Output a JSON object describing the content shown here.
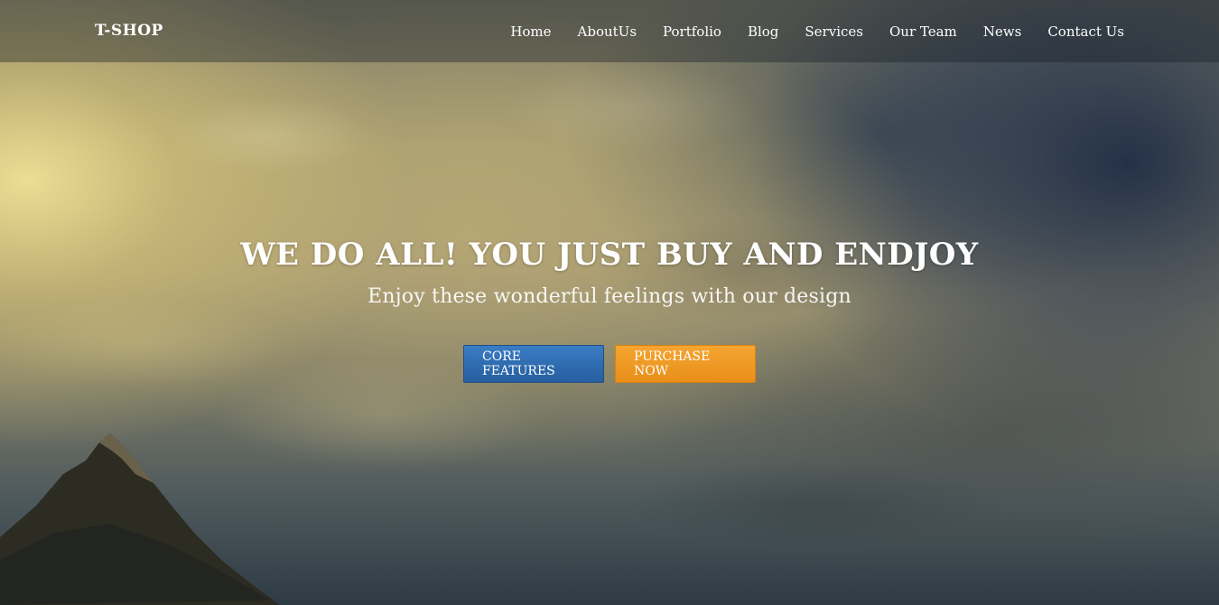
{
  "header": {
    "brand": "T-SHOP",
    "nav": [
      {
        "label": "Home"
      },
      {
        "label": "AboutUs"
      },
      {
        "label": "Portfolio"
      },
      {
        "label": "Blog"
      },
      {
        "label": "Services"
      },
      {
        "label": "Our Team"
      },
      {
        "label": "News"
      },
      {
        "label": "Contact Us"
      }
    ]
  },
  "hero": {
    "title": "WE DO ALL! YOU JUST BUY AND ENDJOY",
    "subtitle": "Enjoy these wonderful feelings with our design",
    "buttons": {
      "core_features": "CORE FEATURES",
      "purchase_now": "PURCHASE NOW"
    }
  },
  "colors": {
    "primary_button": "#2e6db2",
    "accent_button": "#f09a22",
    "nav_text": "#ffffff"
  }
}
